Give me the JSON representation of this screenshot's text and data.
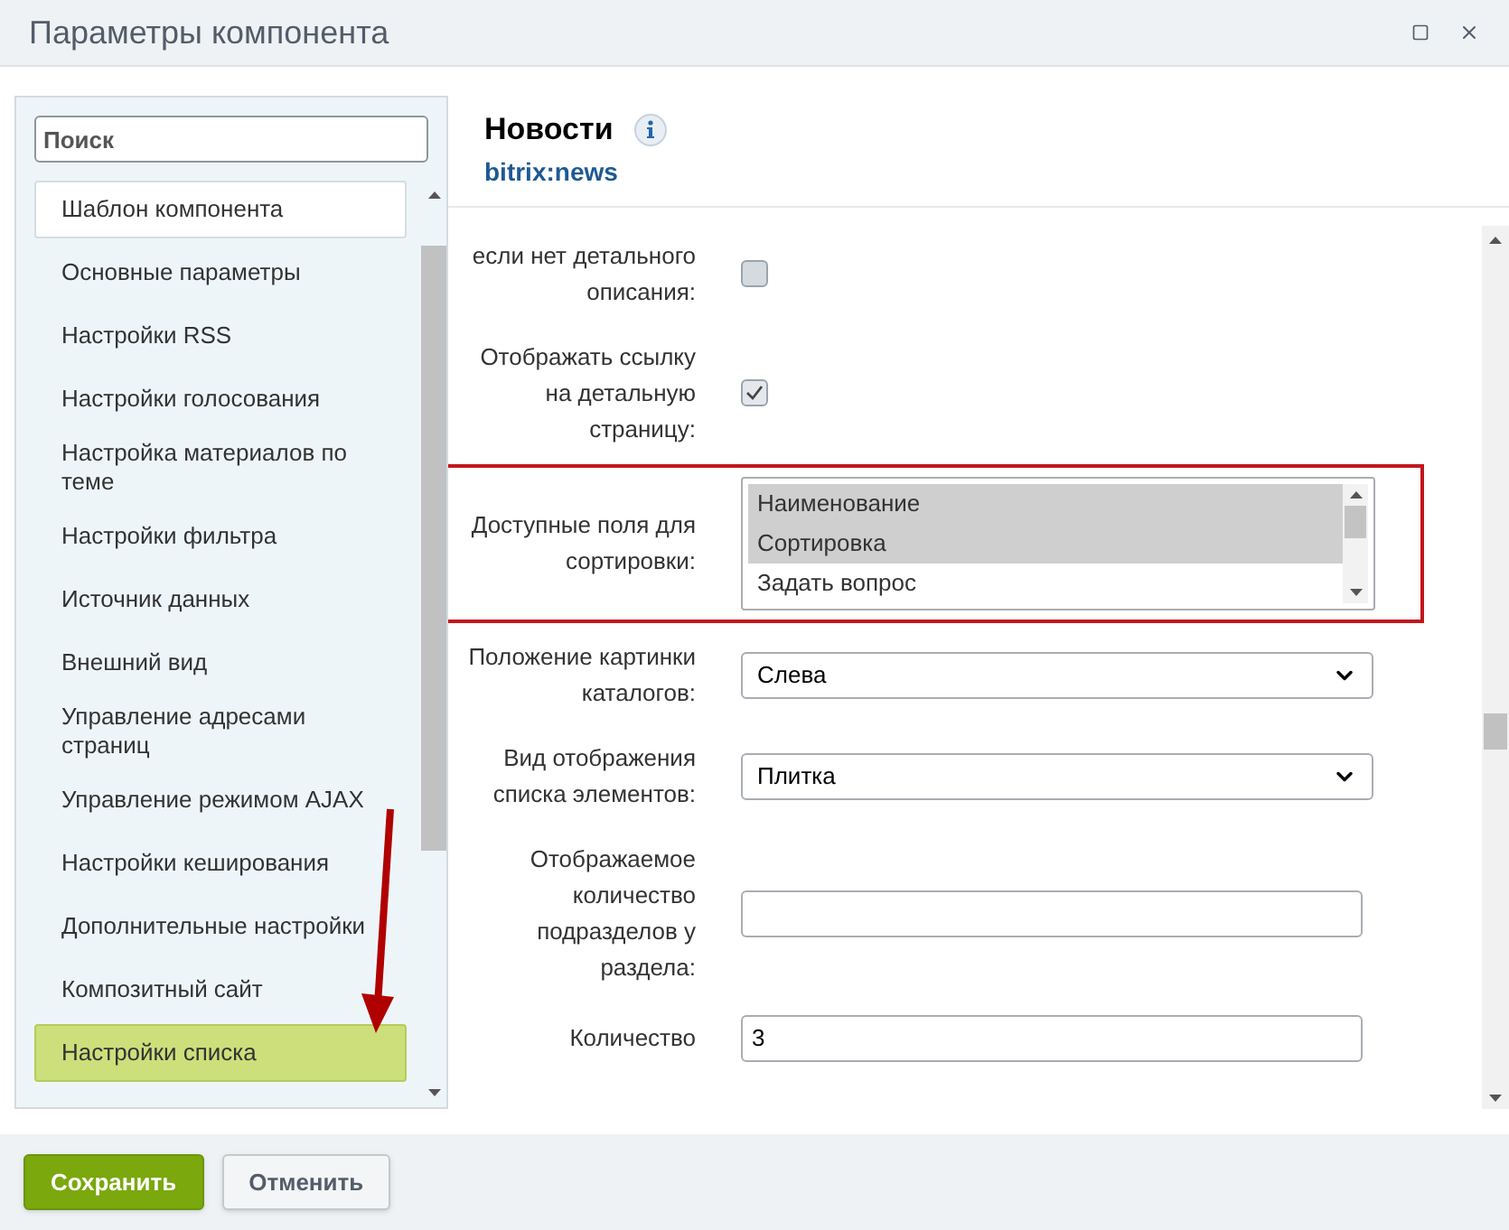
{
  "window": {
    "title": "Параметры компонента"
  },
  "sidebar": {
    "search": {
      "placeholder": "Поиск"
    },
    "items": [
      {
        "label": "Шаблон компонента",
        "selected": false,
        "framed": true
      },
      {
        "label": "Основные параметры",
        "selected": false,
        "framed": false
      },
      {
        "label": "Настройки RSS",
        "selected": false,
        "framed": false
      },
      {
        "label": "Настройки голосования",
        "selected": false,
        "framed": false
      },
      {
        "label": "Настройка материалов по теме",
        "selected": false,
        "framed": false
      },
      {
        "label": "Настройки фильтра",
        "selected": false,
        "framed": false
      },
      {
        "label": "Источник данных",
        "selected": false,
        "framed": false
      },
      {
        "label": "Внешний вид",
        "selected": false,
        "framed": false
      },
      {
        "label": "Управление адресами страниц",
        "selected": false,
        "framed": false
      },
      {
        "label": "Управление режимом AJAX",
        "selected": false,
        "framed": false
      },
      {
        "label": "Настройки кеширования",
        "selected": false,
        "framed": false
      },
      {
        "label": "Дополнительные настройки",
        "selected": false,
        "framed": false
      },
      {
        "label": "Композитный сайт",
        "selected": false,
        "framed": false
      },
      {
        "label": "Настройки списка",
        "selected": true,
        "framed": false
      }
    ]
  },
  "component": {
    "title": "Новости",
    "code": "bitrix:news"
  },
  "fields": [
    {
      "kind": "checkbox",
      "label": "если нет детального описания:",
      "checked": false,
      "highlighted": false
    },
    {
      "kind": "checkbox",
      "label": "Отображать ссылку на детальную страницу:",
      "checked": true,
      "highlighted": false
    },
    {
      "kind": "listbox",
      "label": "Доступные поля для сортировки:",
      "highlighted": true,
      "options": [
        {
          "label": "Наименование",
          "selected": true
        },
        {
          "label": "Сортировка",
          "selected": true
        },
        {
          "label": "Задать вопрос",
          "selected": false
        }
      ]
    },
    {
      "kind": "select",
      "label": "Положение картинки каталогов:",
      "value": "Слева",
      "highlighted": false
    },
    {
      "kind": "select",
      "label": "Вид отображения списка элементов:",
      "value": "Плитка",
      "highlighted": false
    },
    {
      "kind": "text",
      "label": "Отображаемое количество подразделов у раздела:",
      "highlighted": false
    },
    {
      "kind": "text",
      "label": "Количество",
      "value": "3",
      "highlighted": false
    }
  ],
  "buttons": [
    {
      "label": "Сохранить",
      "kind": "primary"
    },
    {
      "label": "Отменить",
      "kind": "secondary"
    }
  ]
}
